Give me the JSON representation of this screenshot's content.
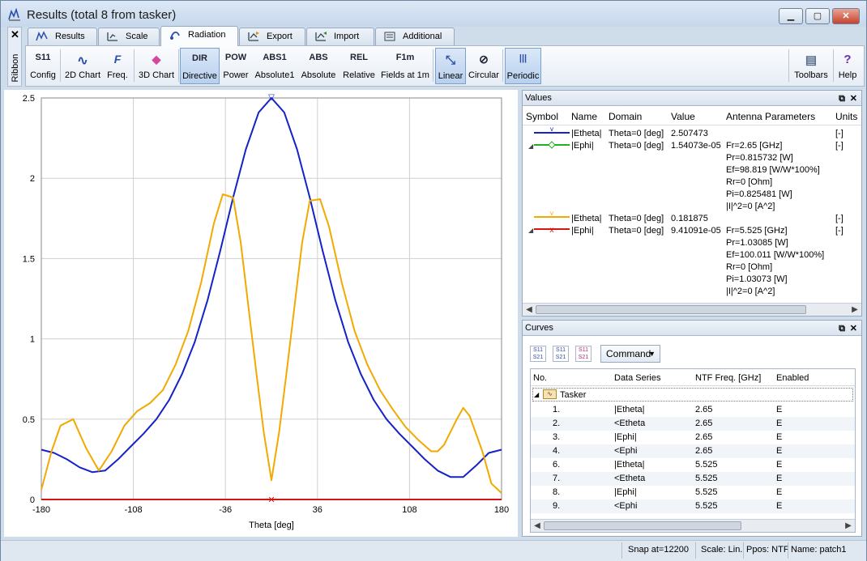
{
  "window": {
    "title": "Results (total 8 from tasker)"
  },
  "ribbon": {
    "close": "✕",
    "label": "Ribbon"
  },
  "tabs": [
    "Results",
    "Scale",
    "Radiation",
    "Export",
    "Import",
    "Additional"
  ],
  "toolbar": {
    "buttons": [
      {
        "glyph": "S11",
        "label": "Config"
      },
      {
        "glyph": "∿",
        "label": "2D Chart"
      },
      {
        "glyph": "F",
        "label": "Freq."
      },
      {
        "glyph": "◆",
        "label": "3D Chart"
      },
      {
        "glyph": "DIR",
        "label": "Directive",
        "active": true
      },
      {
        "glyph": "POW",
        "label": "Power"
      },
      {
        "glyph": "ABS1",
        "label": "Absolute1"
      },
      {
        "glyph": "ABS",
        "label": "Absolute"
      },
      {
        "glyph": "REL",
        "label": "Relative"
      },
      {
        "glyph": "F1m",
        "label": "Fields at 1m"
      },
      {
        "glyph": "⤡",
        "label": "Linear",
        "active": true
      },
      {
        "glyph": "⊘",
        "label": "Circular"
      },
      {
        "glyph": "|||",
        "label": "Periodic",
        "active": true
      },
      {
        "glyph": "▤",
        "label": "Toolbars"
      },
      {
        "glyph": "?",
        "label": "Help"
      }
    ]
  },
  "chart_data": {
    "type": "line",
    "xlabel": "Theta [deg]",
    "xlim": [
      -180,
      180
    ],
    "ylim": [
      0,
      2.5
    ],
    "xticks": [
      "-180",
      "-108",
      "-36",
      "36",
      "108",
      "180"
    ],
    "yticks": [
      "0",
      "0.5",
      "1",
      "1.5",
      "2",
      "2.5"
    ],
    "grid": true,
    "series": [
      {
        "name": "|Etheta|",
        "color": "#1522c8",
        "x": [
          -180,
          -170,
          -160,
          -150,
          -140,
          -130,
          -120,
          -110,
          -100,
          -90,
          -80,
          -70,
          -60,
          -50,
          -40,
          -30,
          -20,
          -10,
          0,
          10,
          20,
          30,
          40,
          50,
          60,
          70,
          80,
          90,
          100,
          110,
          120,
          130,
          140,
          150,
          160,
          170,
          180
        ],
        "y": [
          0.31,
          0.29,
          0.25,
          0.2,
          0.17,
          0.18,
          0.25,
          0.33,
          0.41,
          0.5,
          0.62,
          0.78,
          0.98,
          1.24,
          1.55,
          1.88,
          2.18,
          2.41,
          2.5,
          2.41,
          2.18,
          1.88,
          1.55,
          1.24,
          0.98,
          0.78,
          0.62,
          0.5,
          0.41,
          0.33,
          0.25,
          0.18,
          0.14,
          0.14,
          0.21,
          0.29,
          0.31
        ]
      },
      {
        "name": "|Etheta|",
        "color": "#f2a900",
        "x": [
          -180,
          -172,
          -165,
          -155,
          -145,
          -135,
          -125,
          -115,
          -105,
          -95,
          -85,
          -75,
          -65,
          -55,
          -45,
          -38,
          -30,
          -24,
          -18,
          -12,
          -6,
          0,
          6,
          12,
          18,
          24,
          30,
          38,
          45,
          55,
          65,
          75,
          85,
          95,
          105,
          115,
          125,
          130,
          135,
          145,
          150,
          155,
          165,
          172,
          180
        ],
        "y": [
          0.06,
          0.3,
          0.46,
          0.5,
          0.32,
          0.18,
          0.3,
          0.46,
          0.55,
          0.6,
          0.68,
          0.84,
          1.05,
          1.35,
          1.72,
          1.9,
          1.88,
          1.6,
          1.2,
          0.8,
          0.42,
          0.12,
          0.42,
          0.8,
          1.2,
          1.6,
          1.86,
          1.87,
          1.7,
          1.35,
          1.05,
          0.84,
          0.68,
          0.56,
          0.45,
          0.37,
          0.3,
          0.3,
          0.34,
          0.5,
          0.57,
          0.52,
          0.3,
          0.1,
          0.04
        ]
      },
      {
        "name": "|Ephi|",
        "color": "#20b020",
        "x": [
          -180,
          180
        ],
        "y": [
          2e-05,
          2e-05
        ]
      },
      {
        "name": "|Ephi|",
        "color": "#d41616",
        "x": [
          -180,
          180
        ],
        "y": [
          0.0001,
          0.0001
        ]
      }
    ]
  },
  "values_panel": {
    "title": "Values",
    "headers": [
      "Symbol",
      "Name",
      "Domain",
      "Value",
      "Antenna Parameters",
      "Units"
    ],
    "rows": [
      {
        "name": "|Etheta|",
        "domain": "Theta=0 [deg]",
        "value": "2.507473",
        "params": [],
        "units": "[-]"
      },
      {
        "name": "|Ephi|",
        "domain": "Theta=0 [deg]",
        "value": "1.54073e-05",
        "params": [
          "Fr=2.65 [GHz]",
          "Pr=0.815732 [W]",
          "Ef=98.819 [W/W*100%]",
          "Rr=0 [Ohm]",
          "Pi=0.825481 [W]",
          "|I|^2=0 [A^2]"
        ],
        "units": "[-]"
      },
      {
        "name": "|Etheta|",
        "domain": "Theta=0 [deg]",
        "value": "0.181875",
        "params": [],
        "units": "[-]"
      },
      {
        "name": "|Ephi|",
        "domain": "Theta=0 [deg]",
        "value": "9.41091e-05",
        "params": [
          "Fr=5.525 [GHz]",
          "Pr=1.03085 [W]",
          "Ef=100.011 [W/W*100%]",
          "Rr=0 [Ohm]",
          "Pi=1.03073 [W]",
          "|I|^2=0 [A^2]"
        ],
        "units": "[-]"
      }
    ]
  },
  "curves_panel": {
    "title": "Curves",
    "command": "Command",
    "headers": [
      "No.",
      "Data Series",
      "NTF Freq. [GHz]",
      "Enabled"
    ],
    "group": "Tasker",
    "rows": [
      {
        "no": "1.",
        "series": "|Etheta|",
        "freq": "2.65",
        "en": "E"
      },
      {
        "no": "2.",
        "series": "<Etheta",
        "freq": "2.65",
        "en": "E"
      },
      {
        "no": "3.",
        "series": "|Ephi|",
        "freq": "2.65",
        "en": "E"
      },
      {
        "no": "4.",
        "series": "<Ephi",
        "freq": "2.65",
        "en": "E"
      },
      {
        "no": "6.",
        "series": "|Etheta|",
        "freq": "5.525",
        "en": "E"
      },
      {
        "no": "7.",
        "series": "<Etheta",
        "freq": "5.525",
        "en": "E"
      },
      {
        "no": "8.",
        "series": "|Ephi|",
        "freq": "5.525",
        "en": "E"
      },
      {
        "no": "9.",
        "series": "<Ephi",
        "freq": "5.525",
        "en": "E"
      }
    ]
  },
  "status": {
    "snap": "Snap at=12200",
    "scale": "Scale: Lin.",
    "ppos": "Ppos: NTF",
    "name": "Name: patch1"
  }
}
